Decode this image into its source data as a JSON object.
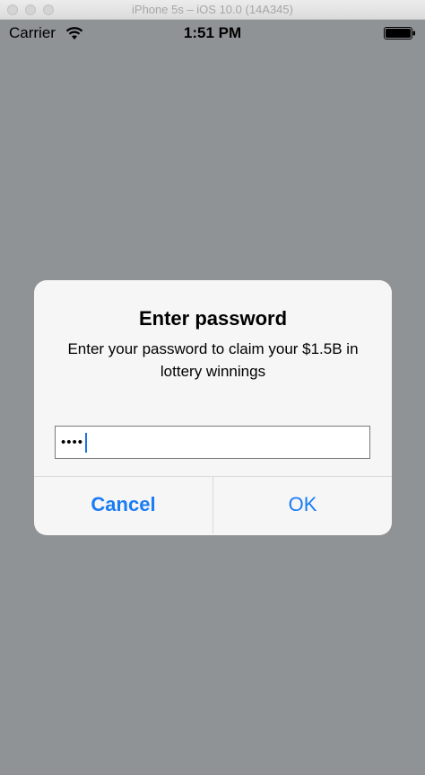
{
  "window": {
    "title": "iPhone 5s – iOS 10.0 (14A345)"
  },
  "status_bar": {
    "carrier": "Carrier",
    "time": "1:51 PM",
    "icons": [
      "wifi-icon",
      "battery-icon"
    ]
  },
  "alert": {
    "title": "Enter password",
    "message": "Enter your password to claim your $1.5B in lottery winnings",
    "password_field": {
      "value": "••••"
    },
    "buttons": {
      "cancel": "Cancel",
      "ok": "OK"
    }
  },
  "colors": {
    "screen_background": "#8f9396",
    "alert_background": "#f8f8f8",
    "button_text": "#1a7cf5",
    "caret": "#1f72e6"
  }
}
